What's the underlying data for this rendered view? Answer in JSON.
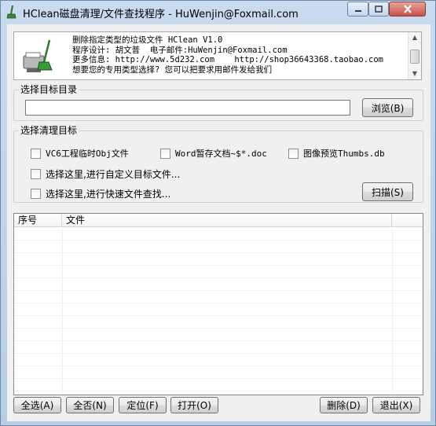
{
  "window": {
    "title": "HClean磁盘清理/文件查找程序 - HuWenjin@Foxmail.com",
    "icons": {
      "app": "broom-icon",
      "minimize": "minimize-icon",
      "maximize": "maximize-icon",
      "close": "close-icon"
    }
  },
  "info": {
    "icon": "shredder-broom-icon",
    "lines": [
      "删除指定类型的垃圾文件 HClean V1.0",
      "程序设计: 胡文普  电子邮件:HuWenjin@Foxmail.com",
      "更多信息: http://www.5d232.com    http://shop36643368.taobao.com",
      "想要您的专用类型选择? 您可以把要求用邮件发给我们"
    ]
  },
  "target_dir": {
    "group_label": "选择目标目录",
    "value": "",
    "browse_label": "浏览(B)"
  },
  "clean_targets": {
    "group_label": "选择清理目标",
    "options": [
      {
        "label": "VC6工程临时Obj文件",
        "checked": false
      },
      {
        "label": "Word暂存文档~$*.doc",
        "checked": false
      },
      {
        "label": "图像预览Thumbs.db",
        "checked": false
      },
      {
        "label": "选择这里,进行自定义目标文件...",
        "checked": false
      },
      {
        "label": "选择这里,进行快速文件查找...",
        "checked": false
      }
    ],
    "scan_label": "扫描(S)"
  },
  "file_list": {
    "columns": [
      "序号",
      "文件"
    ],
    "rows": []
  },
  "actions": {
    "select_all": "全选(A)",
    "select_none": "全否(N)",
    "locate": "定位(F)",
    "open": "打开(O)",
    "delete": "删除(D)",
    "exit": "退出(X)"
  },
  "colors": {
    "window_frame": "#b7cde6",
    "client_bg": "#f0f0f0",
    "close_button": "#c75050"
  }
}
